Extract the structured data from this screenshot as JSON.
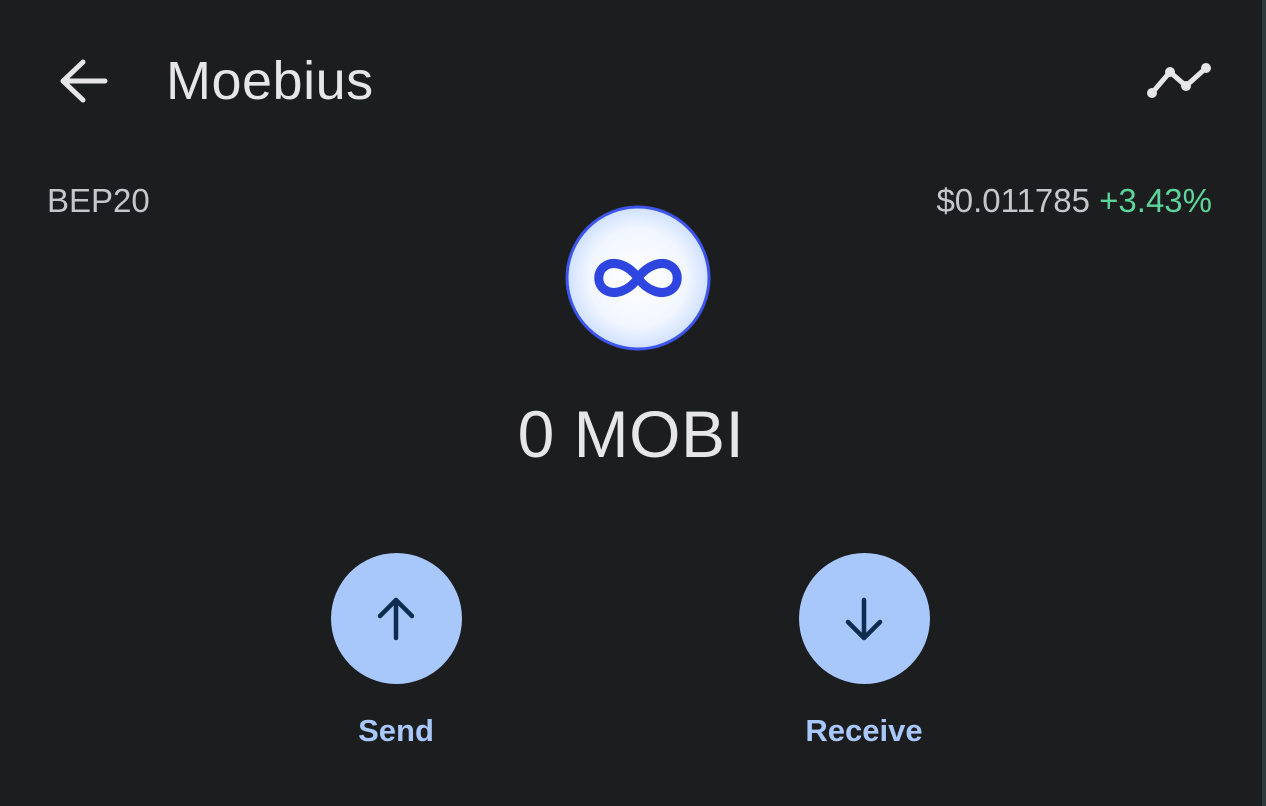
{
  "header": {
    "title": "Moebius",
    "back_icon": "arrow-left-icon",
    "chart_icon": "trend-line-icon"
  },
  "token": {
    "network": "BEP20",
    "price": "$0.011785",
    "change": "+3.43%",
    "balance": "0 MOBI",
    "logo_icon": "infinity-icon"
  },
  "actions": {
    "send": {
      "label": "Send",
      "icon": "arrow-up-icon"
    },
    "receive": {
      "label": "Receive",
      "icon": "arrow-down-icon"
    }
  },
  "colors": {
    "background": "#1c1d1f",
    "accent": "#a8c7fa",
    "positive": "#5dd49a",
    "logo_blue": "#2f45e0"
  }
}
